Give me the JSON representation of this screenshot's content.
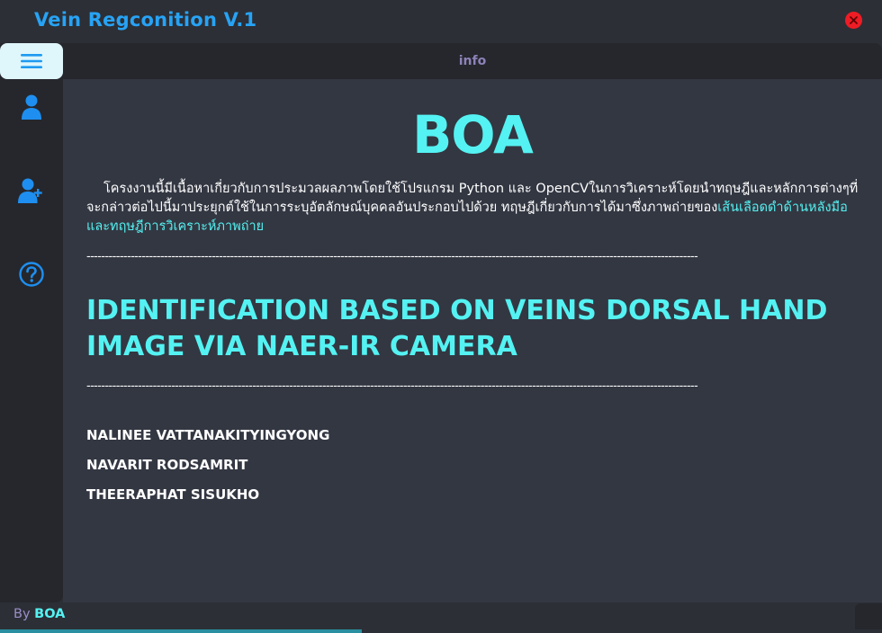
{
  "window": {
    "title": "Vein Regconition V.1"
  },
  "header": {
    "section_label": "info"
  },
  "sidebar": {
    "items": [
      {
        "icon": "menu-icon"
      },
      {
        "icon": "user-icon"
      },
      {
        "icon": "user-add-icon"
      },
      {
        "icon": "help-icon"
      }
    ]
  },
  "content": {
    "heading": "BOA",
    "description_main": "โครงงานนี้มีเนื้อหาเกี่ยวกับการประมวลผลภาพโดยใช้โปรแกรม Python และ OpenCVในการวิเคราะห์โดยนำทฤษฎีและหลักการต่างๆที่จะกล่าวต่อไปนี้มาประยุกต์ใช้ในการระบุอัตลักษณ์บุคคลอันประกอบไปด้วย ทฤษฎีเกี่ยวกับการได้มาซึ่งภาพถ่ายของ",
    "description_highlight": "เส้นเลือดดำด้านหลังมือและทฤษฎีการวิเคราะห์ภาพถ่าย",
    "separator": "----------------------------------------------------------------------------------------------------------------------------------------------------------------------",
    "project_title": "IDENTIFICATION BASED ON VEINS DORSAL HAND IMAGE VIA NAER-IR CAMERA",
    "authors": [
      "NALINEE VATTANAKITYINGYONG",
      "NAVARIT RODSAMRIT",
      "THEERAPHAT SISUKHO"
    ]
  },
  "footer": {
    "by_label": "By",
    "by_name": "BOA"
  },
  "colors": {
    "accent_blue": "#27a3f5",
    "accent_cyan": "#54f2f2",
    "close_red": "#ee1c25",
    "sidebar_bg": "#25272d",
    "content_bg": "#333742"
  }
}
